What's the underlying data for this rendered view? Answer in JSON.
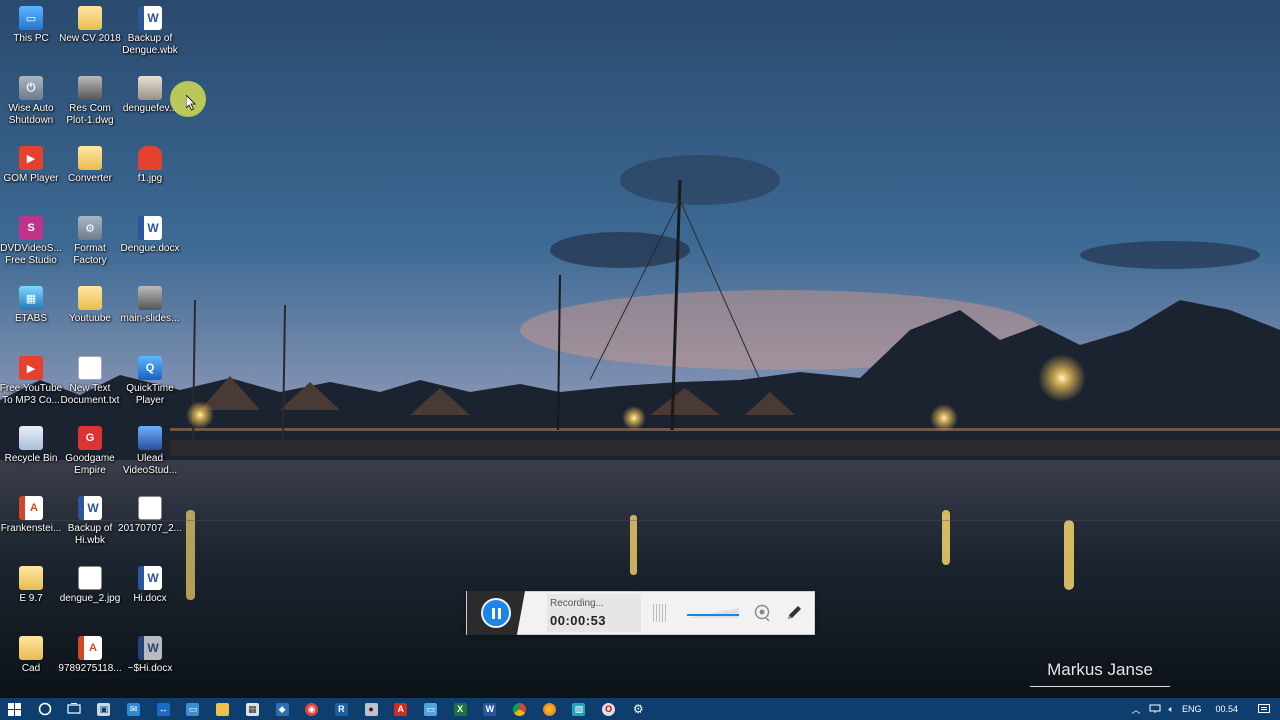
{
  "desktop": {
    "icons": [
      {
        "label": "This PC",
        "icon": "this-pc-icon"
      },
      {
        "label": "New CV 2018",
        "icon": "folder-icon"
      },
      {
        "label": "Backup of\nDengue.wbk",
        "icon": "word-backup-icon"
      },
      {
        "label": "Wise Auto\nShutdown",
        "icon": "wise-shutdown-icon"
      },
      {
        "label": "Res Com\nPlot-1.dwg",
        "icon": "dwg-file-icon"
      },
      {
        "label": "denguefev...",
        "icon": "image-file-icon"
      },
      {
        "label": "GOM Player",
        "icon": "gom-player-icon"
      },
      {
        "label": "Converter",
        "icon": "folder-icon"
      },
      {
        "label": "f1.jpg",
        "icon": "image-file-icon"
      },
      {
        "label": "DVDVideoS...\nFree Studio",
        "icon": "dvdvideosoft-icon"
      },
      {
        "label": "Format\nFactory",
        "icon": "format-factory-icon"
      },
      {
        "label": "Dengue.docx",
        "icon": "word-doc-icon"
      },
      {
        "label": "ETABS",
        "icon": "etabs-icon"
      },
      {
        "label": "Youtuube",
        "icon": "folder-icon"
      },
      {
        "label": "main-slides...",
        "icon": "image-file-icon"
      },
      {
        "label": "Free YouTube\nTo MP3 Co...",
        "icon": "youtube-mp3-icon"
      },
      {
        "label": "New Text\nDocument.txt",
        "icon": "text-file-icon"
      },
      {
        "label": "QuickTime\nPlayer",
        "icon": "quicktime-icon"
      },
      {
        "label": "Recycle Bin",
        "icon": "recycle-bin-icon"
      },
      {
        "label": "Goodgame\nEmpire",
        "icon": "goodgame-icon"
      },
      {
        "label": "Ulead\nVideoStud...",
        "icon": "ulead-icon"
      },
      {
        "label": "Frankenstei...",
        "icon": "pdf-file-icon"
      },
      {
        "label": "Backup of\nHi.wbk",
        "icon": "word-backup-icon"
      },
      {
        "label": "20170707_2...",
        "icon": "image-file-icon"
      },
      {
        "label": "E 9.7",
        "icon": "folder-icon"
      },
      {
        "label": "dengue_2.jpg",
        "icon": "image-file-icon"
      },
      {
        "label": "Hi.docx",
        "icon": "word-doc-icon"
      },
      {
        "label": "Cad",
        "icon": "folder-icon"
      },
      {
        "label": "9789275118...",
        "icon": "pdf-file-icon"
      },
      {
        "label": "~$Hi.docx",
        "icon": "word-doc-icon"
      }
    ]
  },
  "recorder": {
    "status": "Recording...",
    "time": "00:00:53"
  },
  "watermark": "Markus Janse",
  "taskbar": {
    "apps": [
      "start",
      "search",
      "task-view",
      "store",
      "mail",
      "teamviewer",
      "remote",
      "file-explorer",
      "calculator",
      "sketchup",
      "vpn",
      "revit",
      "imageburn",
      "acrobat",
      "desktop",
      "excel",
      "word",
      "chrome",
      "firefox",
      "photos",
      "opera",
      "settings"
    ],
    "tray": {
      "language": "ENG",
      "time": "00.54"
    }
  },
  "colors": {
    "taskbar": "#0d3e6e",
    "accent": "#1a86e8"
  }
}
